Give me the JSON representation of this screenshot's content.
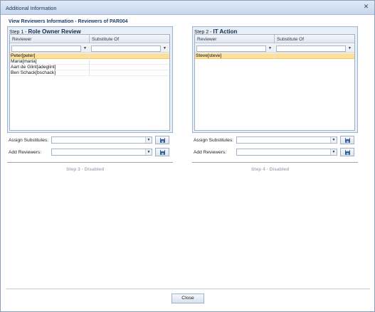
{
  "window": {
    "title": "Additional Information",
    "close_icon": "close-icon"
  },
  "info_title": "View Reviewers Information - Reviewers of PAR004",
  "steps": [
    {
      "prefix": "Step 1 - ",
      "name": "Role Owner Review",
      "columns": [
        "Reviewer",
        "Substitute Of"
      ],
      "rows": [
        {
          "reviewer": "Peter[peter]",
          "substitute_of": "",
          "selected": true
        },
        {
          "reviewer": "Maria[maria]",
          "substitute_of": "",
          "selected": false
        },
        {
          "reviewer": "Aart de Glint[adeglint]",
          "substitute_of": "",
          "selected": false
        },
        {
          "reviewer": "Ben Schack[bschack]",
          "substitute_of": "",
          "selected": false
        }
      ],
      "assign_substitutes_label": "Assign Substitutes:",
      "assign_substitutes_value": "",
      "add_reviewers_label": "Add Reviewers:",
      "add_reviewers_value": ""
    },
    {
      "prefix": "Step 2 - ",
      "name": "IT Action",
      "columns": [
        "Reviewer",
        "Substitute Of"
      ],
      "rows": [
        {
          "reviewer": "Steve[steve]",
          "substitute_of": "",
          "selected": true
        }
      ],
      "assign_substitutes_label": "Assign Substitutes:",
      "assign_substitutes_value": "",
      "add_reviewers_label": "Add Reviewers:",
      "add_reviewers_value": ""
    }
  ],
  "disabled_steps": [
    "Step 3 - Disabled",
    "Step 4 - Disabled"
  ],
  "footer": {
    "close_label": "Close"
  },
  "colors": {
    "selected_row": "#fcdf9a",
    "panel_bg": "#e6eef8",
    "title_bar": "#c7d7ee",
    "disabled_text": "#a8b0bb"
  }
}
